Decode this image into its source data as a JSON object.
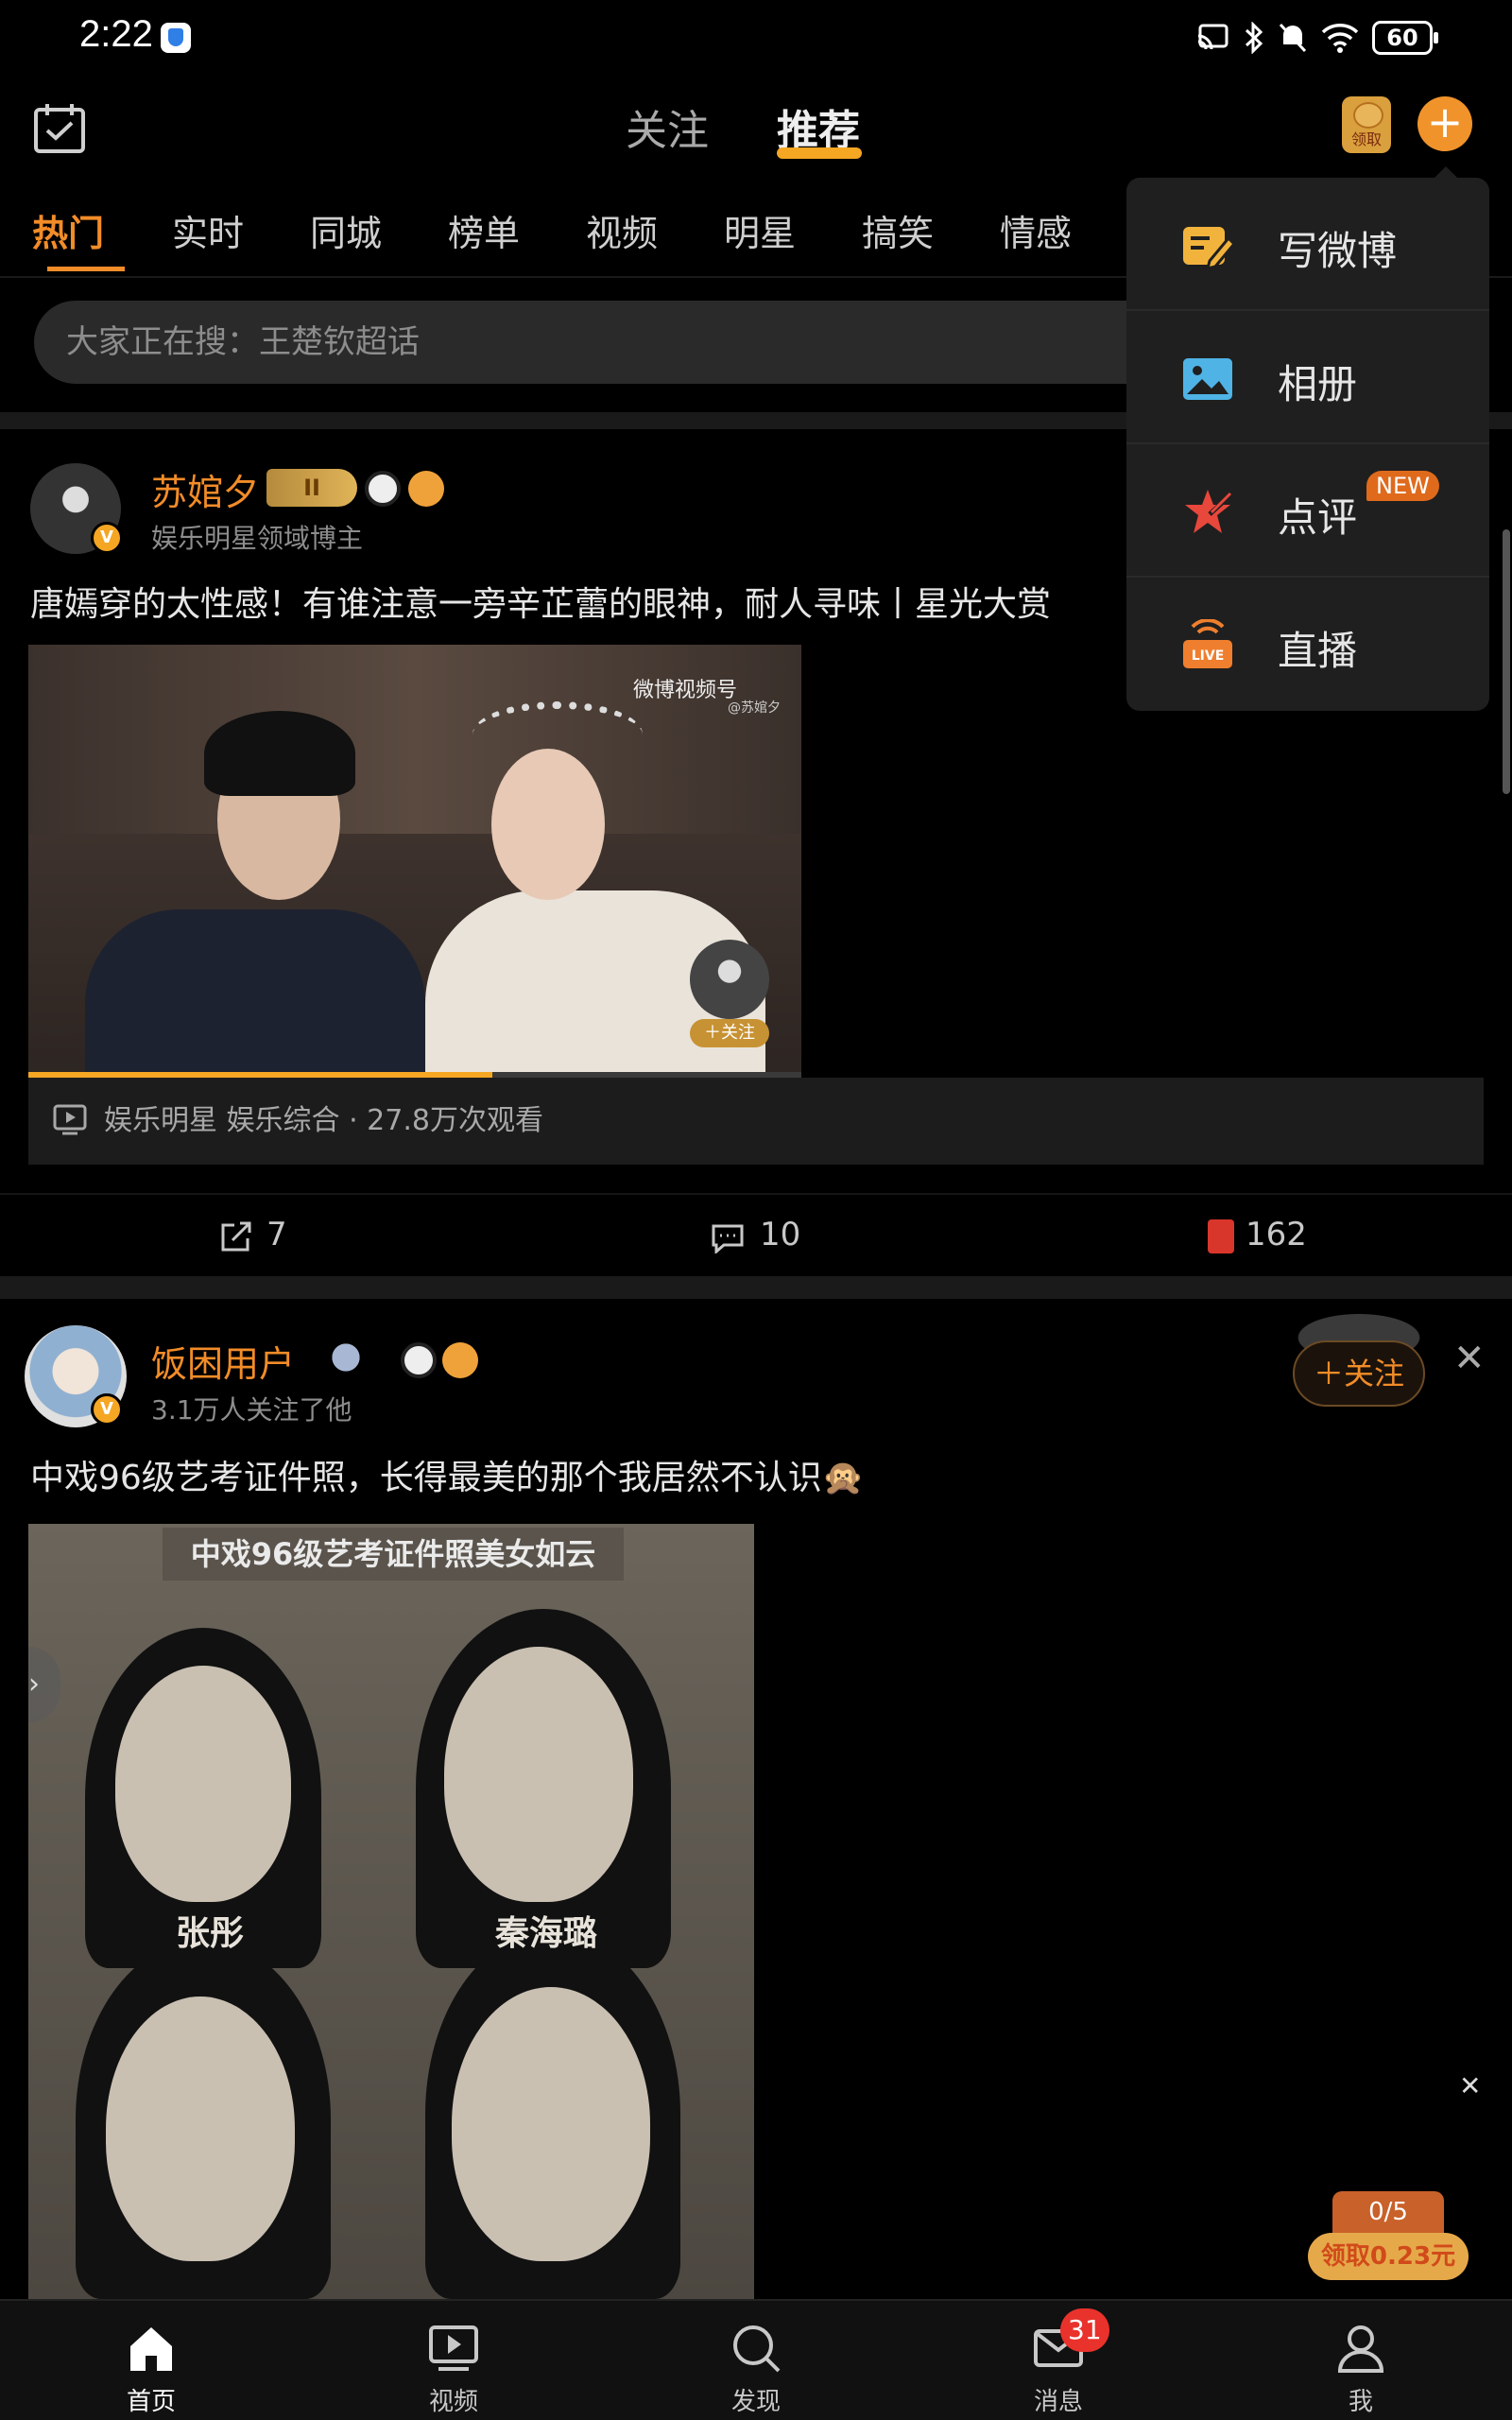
{
  "status": {
    "time": "2:22",
    "battery": "60"
  },
  "topnav": {
    "follow": "关注",
    "recommend": "推荐",
    "redpacket": "领取"
  },
  "categories": [
    "热门",
    "实时",
    "同城",
    "榜单",
    "视频",
    "明星",
    "搞笑",
    "情感"
  ],
  "search": {
    "placeholder": "大家正在搜：王楚钦超话"
  },
  "dropdown": [
    {
      "label": "写微博",
      "icon": "compose-icon"
    },
    {
      "label": "相册",
      "icon": "album-icon"
    },
    {
      "label": "点评",
      "icon": "review-icon",
      "badge": "NEW"
    },
    {
      "label": "直播",
      "icon": "live-icon",
      "icon_text": "LIVE"
    }
  ],
  "post1": {
    "user": "苏婠夕",
    "level": "II",
    "subtitle": "娱乐明星领域博主",
    "text": "唐嫣穿的太性感！有谁注意一旁辛芷蕾的眼神，耐人寻味丨星光大赏",
    "watermark": "微博视频号",
    "watermark_sub": "@苏婠夕",
    "follow_overlay": "＋关注",
    "progress": 0.6,
    "media_info": "娱乐明星 娱乐综合 · 27.8万次观看",
    "shares": "7",
    "comments": "10",
    "likes": "162"
  },
  "post2": {
    "user": "饭困用户",
    "subtitle": "3.1万人关注了他",
    "follow": "＋关注",
    "text": "中戏96级艺考证件照，长得最美的那个我居然不认识🙊",
    "image_title": "中戏96级艺考证件照美女如云",
    "name1": "张彤",
    "name2": "秦海璐"
  },
  "reward": {
    "count": "0/5",
    "claim": "领取0.23元"
  },
  "tabbar": [
    {
      "label": "首页",
      "icon": "home-icon"
    },
    {
      "label": "视频",
      "icon": "video-icon"
    },
    {
      "label": "发现",
      "icon": "discover-icon"
    },
    {
      "label": "消息",
      "icon": "message-icon",
      "badge": "31"
    },
    {
      "label": "我",
      "icon": "profile-icon"
    }
  ]
}
